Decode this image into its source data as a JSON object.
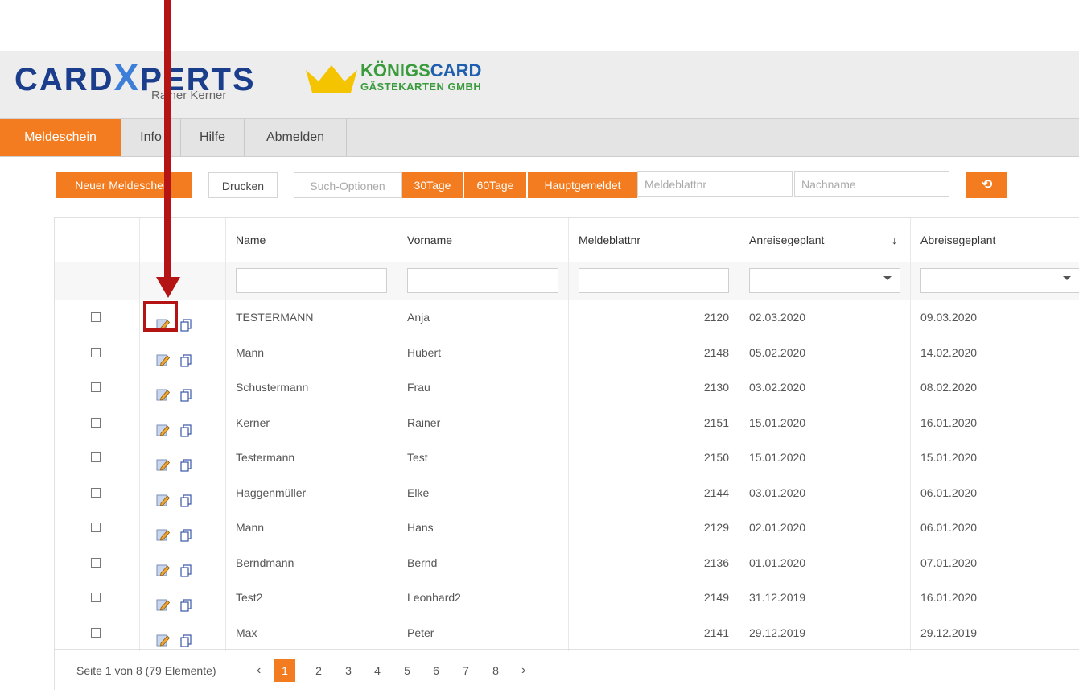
{
  "header": {
    "brand_left": {
      "part1": "CARD",
      "part2": "X",
      "part3": "PERTS",
      "sub": "Rainer Kerner"
    },
    "brand_right": {
      "line1_a": "KÖNIGS",
      "line1_b": "CARD",
      "line2": "GÄSTEKARTEN GMBH"
    }
  },
  "nav": {
    "items": [
      {
        "label": "Meldeschein",
        "active": true
      },
      {
        "label": "Info"
      },
      {
        "label": "Hilfe"
      },
      {
        "label": "Abmelden"
      }
    ]
  },
  "toolbar": {
    "new_label": "Neuer Meldeschein",
    "print_label": "Drucken",
    "search_options_label": "Such-Optionen",
    "days30_label": "30Tage",
    "days60_label": "60Tage",
    "main_label": "Hauptgemeldet",
    "meldeblattnr_placeholder": "Meldeblattnr",
    "nachname_placeholder": "Nachname",
    "refresh_glyph": "⟲"
  },
  "grid": {
    "columns": [
      "Name",
      "Vorname",
      "Meldeblattnr",
      "Anreisegeplant",
      "Abreisegeplant"
    ],
    "sort_glyph": "↓",
    "rows": [
      {
        "name": "TESTERMANN",
        "vorname": "Anja",
        "nr": "2120",
        "an": "02.03.2020",
        "ab": "09.03.2020"
      },
      {
        "name": "Mann",
        "vorname": "Hubert",
        "nr": "2148",
        "an": "05.02.2020",
        "ab": "14.02.2020"
      },
      {
        "name": "Schustermann",
        "vorname": "Frau",
        "nr": "2130",
        "an": "03.02.2020",
        "ab": "08.02.2020"
      },
      {
        "name": "Kerner",
        "vorname": "Rainer",
        "nr": "2151",
        "an": "15.01.2020",
        "ab": "16.01.2020"
      },
      {
        "name": "Testermann",
        "vorname": "Test",
        "nr": "2150",
        "an": "15.01.2020",
        "ab": "15.01.2020"
      },
      {
        "name": "Haggenmüller",
        "vorname": "Elke",
        "nr": "2144",
        "an": "03.01.2020",
        "ab": "06.01.2020"
      },
      {
        "name": "Mann",
        "vorname": "Hans",
        "nr": "2129",
        "an": "02.01.2020",
        "ab": "06.01.2020"
      },
      {
        "name": "Berndmann",
        "vorname": "Bernd",
        "nr": "2136",
        "an": "01.01.2020",
        "ab": "07.01.2020"
      },
      {
        "name": "Test2",
        "vorname": "Leonhard2",
        "nr": "2149",
        "an": "31.12.2019",
        "ab": "16.01.2020"
      },
      {
        "name": "Max",
        "vorname": "Peter",
        "nr": "2141",
        "an": "29.12.2019",
        "ab": "29.12.2019"
      }
    ]
  },
  "pager": {
    "info": "Seite 1 von 8 (79 Elemente)",
    "prev": "‹",
    "next": "›",
    "pages": [
      "1",
      "2",
      "3",
      "4",
      "5",
      "6",
      "7",
      "8"
    ],
    "current": "1"
  },
  "colors": {
    "accent": "#f47c20",
    "annotation": "#b41414",
    "brand_blue": "#1a3d8c",
    "brand_green": "#3a9b3c"
  }
}
